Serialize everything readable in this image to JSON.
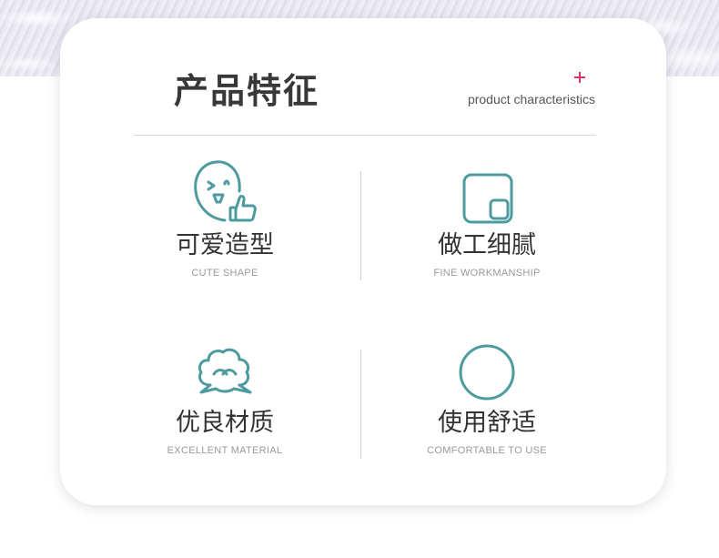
{
  "header": {
    "title_cn": "产品特征",
    "title_en": "product characteristics"
  },
  "colors": {
    "accent_teal": "#4d9b9f",
    "accent_pink": "#d6336c",
    "text_dark": "#333333",
    "text_gray": "#9a9a9a"
  },
  "features": [
    {
      "title_cn": "可爱造型",
      "title_en": "CUTE SHAPE",
      "icon": "smiley-thumbs-up-icon"
    },
    {
      "title_cn": "做工细腻",
      "title_en": "FINE WORKMANSHIP",
      "icon": "rounded-squares-icon"
    },
    {
      "title_cn": "优良材质",
      "title_en": "EXCELLENT MATERIAL",
      "icon": "cotton-cloud-icon"
    },
    {
      "title_cn": "使用舒适",
      "title_en": "COMFORTABLE TO USE",
      "icon": "circle-icon"
    }
  ]
}
